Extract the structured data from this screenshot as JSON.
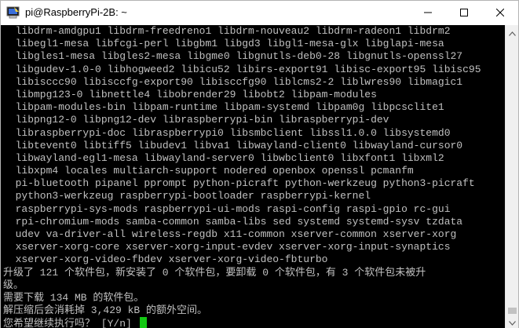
{
  "window": {
    "title": "pi@RaspberryPi-2B: ~",
    "app_icon": "putty-terminal-icon",
    "controls": {
      "minimize_icon": "minimize-icon",
      "maximize_icon": "maximize-icon",
      "close_icon": "close-icon"
    }
  },
  "terminal": {
    "background": "#000000",
    "text_color": "#c0c0c0",
    "cursor_color": "#13c813",
    "lines": [
      "  libdrm-amdgpu1 libdrm-freedreno1 libdrm-nouveau2 libdrm-radeon1 libdrm2",
      "  libegl1-mesa libfcgi-perl libgbm1 libgd3 libgl1-mesa-glx libglapi-mesa",
      "  libgles1-mesa libgles2-mesa libgme0 libgnutls-deb0-28 libgnutls-openssl27",
      "  libgudev-1.0-0 libhogweed2 libicu52 libirs-export91 libisc-export95 libisc95",
      "  libisccc90 libisccfg-export90 libisccfg90 liblcms2-2 liblwres90 libmagic1",
      "  libmpg123-0 libnettle4 libobrender29 libobt2 libpam-modules",
      "  libpam-modules-bin libpam-runtime libpam-systemd libpam0g libpcsclite1",
      "  libpng12-0 libpng12-dev libraspberrypi-bin libraspberrypi-dev",
      "  libraspberrypi-doc libraspberrypi0 libsmbclient libssl1.0.0 libsystemd0",
      "  libtevent0 libtiff5 libudev1 libva1 libwayland-client0 libwayland-cursor0",
      "  libwayland-egl1-mesa libwayland-server0 libwbclient0 libxfont1 libxml2",
      "  libxpm4 locales multiarch-support nodered openbox openssl pcmanfm",
      "  pi-bluetooth pipanel pprompt python-picraft python-werkzeug python3-picraft",
      "  python3-werkzeug raspberrypi-bootloader raspberrypi-kernel",
      "  raspberrypi-sys-mods raspberrypi-ui-mods raspi-config raspi-gpio rc-gui",
      "  rpi-chromium-mods samba-common samba-libs sed systemd systemd-sysv tzdata",
      "  udev va-driver-all wireless-regdb x11-common xserver-common xserver-xorg",
      "  xserver-xorg-core xserver-xorg-input-evdev xserver-xorg-input-synaptics",
      "  xserver-xorg-video-fbdev xserver-xorg-video-fbturbo",
      "升级了 121 个软件包，新安装了 0 个软件包，要卸载 0 个软件包，有 3 个软件包未被升",
      "级。",
      "需要下载 134 MB 的软件包。",
      "解压缩后会消耗掉 3,429 kB 的额外空间。"
    ],
    "prompt": "您希望继续执行吗？ [Y/n] "
  },
  "scrollbar": {
    "up_icon": "scroll-up-arrow-icon",
    "down_icon": "scroll-down-arrow-icon"
  }
}
